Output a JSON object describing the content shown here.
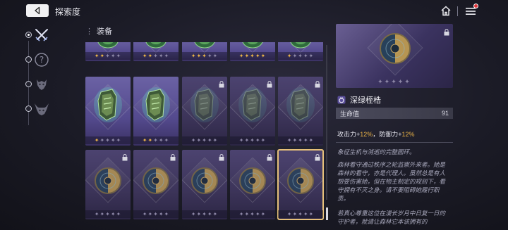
{
  "header": {
    "title": "探索度",
    "back_icon": "back-arrow-icon",
    "home_icon": "home-icon",
    "menu_icon": "menu-icon",
    "notification": "red-dot"
  },
  "sidebar": {
    "items": [
      {
        "icon": "crossed-swords-icon",
        "active": true
      },
      {
        "icon": "question-mark-icon",
        "active": false
      },
      {
        "icon": "demon-mask-icon",
        "active": false
      },
      {
        "icon": "horned-demon-icon",
        "active": false
      }
    ]
  },
  "section": {
    "label": "装备"
  },
  "grid": {
    "rows": [
      {
        "item": "green-gem-tile",
        "cards": [
          {
            "stars": 2,
            "locked": false
          },
          {
            "stars": 2,
            "locked": false
          },
          {
            "stars": 3,
            "locked": false
          },
          {
            "stars": 5,
            "locked": false
          },
          {
            "stars": 1,
            "locked": false
          }
        ]
      },
      {
        "item": "green-gauntlet",
        "cards": [
          {
            "stars": 1,
            "locked": false
          },
          {
            "stars": 2,
            "locked": false
          },
          {
            "stars": 0,
            "locked": true
          },
          {
            "stars": 0,
            "locked": true
          },
          {
            "stars": 0,
            "locked": true
          }
        ]
      },
      {
        "item": "half-gold-shield",
        "cards": [
          {
            "stars": 0,
            "locked": true
          },
          {
            "stars": 0,
            "locked": true
          },
          {
            "stars": 0,
            "locked": true
          },
          {
            "stars": 0,
            "locked": true
          },
          {
            "stars": 0,
            "locked": true,
            "selected": true
          }
        ]
      }
    ]
  },
  "detail": {
    "preview_stars": 0,
    "preview_locked": true,
    "item_name": "深绿桎梏",
    "item_icon": "ring-icon",
    "stat_label": "生命值",
    "stat_value": "91",
    "bonus_prefix_1": "攻击力+",
    "bonus_value_1": "12%",
    "bonus_sep": "，防御力+",
    "bonus_value_2": "12%",
    "lore_1": "象征生机与消逝的完整圆环。",
    "lore_2": "森林看守通过秩序之轮监察外来者。她是森林的看守，亦是代理人。虽然总是有人想要伤害她，但在物主制定的规则下，看守拥有不灭之身。请不要阻碍她履行职责。",
    "lore_3": "若真心尊重这位在漫长岁月中日复一日的守护者，就请让森林它本该拥有的"
  },
  "colors": {
    "star_gold": "#e9b247",
    "card_purple": "#544a8e",
    "highlight": "#e9b247"
  }
}
